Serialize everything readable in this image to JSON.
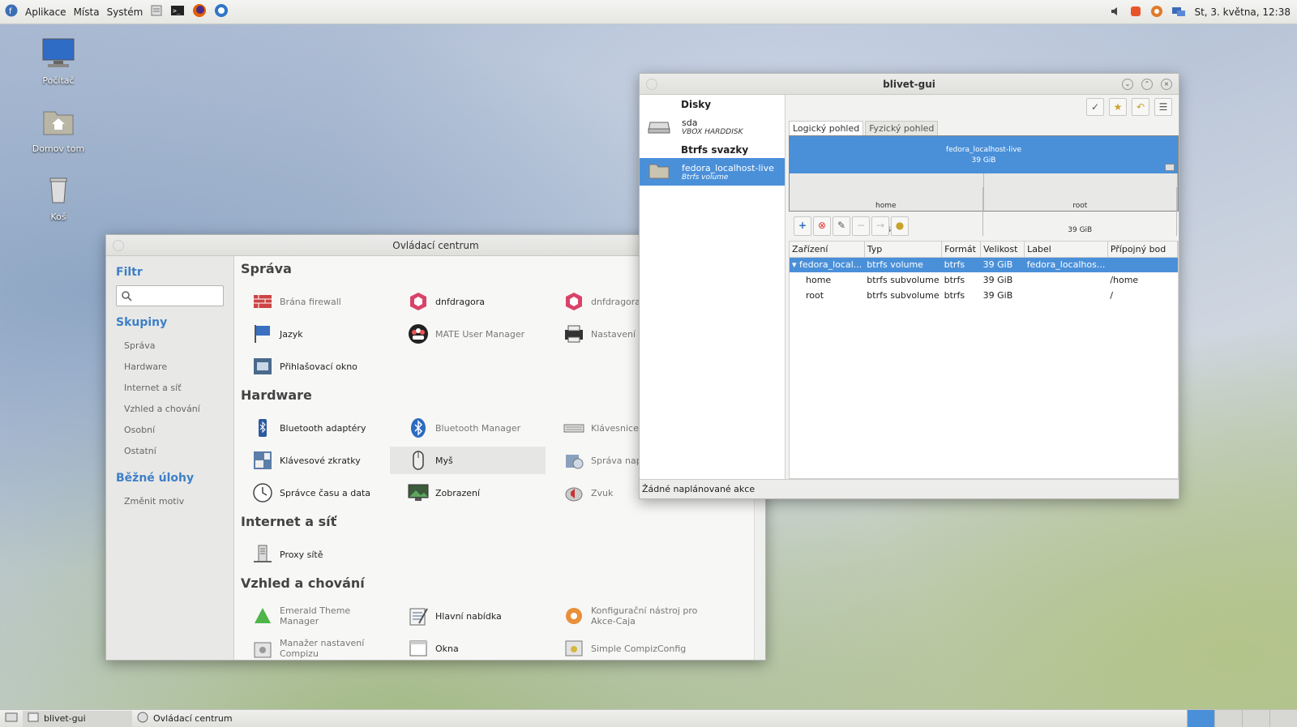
{
  "topbar": {
    "menus": [
      "Aplikace",
      "Místa",
      "Systém"
    ],
    "clock": "St, 3. května, 12:38"
  },
  "desktop": {
    "icons": [
      "Počítač",
      "Domov tom",
      "Koš"
    ]
  },
  "control_center": {
    "title": "Ovládací centrum",
    "filter_heading": "Filtr",
    "search_placeholder": "",
    "groups_heading": "Skupiny",
    "groups": [
      "Správa",
      "Hardware",
      "Internet a síť",
      "Vzhled a chování",
      "Osobní",
      "Ostatní"
    ],
    "tasks_heading": "Běžné úlohy",
    "tasks": [
      "Změnit motiv"
    ],
    "sections": [
      {
        "title": "Správa",
        "items": [
          "Brána firewall",
          "dnfdragora",
          "dnfdragora",
          "Jazyk",
          "MATE User Manager",
          "Nastavení",
          "Přihlašovací okno"
        ]
      },
      {
        "title": "Hardware",
        "items": [
          "Bluetooth adaptéry",
          "Bluetooth Manager",
          "Klávesnice",
          "Klávesové zkratky",
          "Myš",
          "Správa napájení",
          "Správce času a data",
          "Zobrazení",
          "Zvuk"
        ]
      },
      {
        "title": "Internet a síť",
        "items": [
          "Proxy sítě"
        ]
      },
      {
        "title": "Vzhled a chování",
        "items": [
          "Emerald Theme Manager",
          "Hlavní nabídka",
          "Konfigurační nástroj pro Akce-Caja",
          "Manažer nastavení Compizu",
          "Okna",
          "Simple CompizConfig"
        ]
      }
    ]
  },
  "blivet": {
    "title": "blivet-gui",
    "disks_heading": "Disky",
    "disk": {
      "name": "sda",
      "model": "VBOX HARDDISK"
    },
    "btrfs_heading": "Btrfs svazky",
    "volume": {
      "name": "fedora_localhost-live",
      "type": "Btrfs volume"
    },
    "tabs": [
      "Logický pohled",
      "Fyzický pohled"
    ],
    "visual": {
      "top_name": "fedora_localhost-live",
      "top_size": "39 GiB",
      "parts": [
        {
          "name": "home",
          "size": "39 GiB"
        },
        {
          "name": "root",
          "size": "39 GiB"
        }
      ]
    },
    "columns": [
      "Zařízení",
      "Typ",
      "Formát",
      "Velikost",
      "Label",
      "Přípojný bod"
    ],
    "rows": [
      [
        "fedora_local...",
        "btrfs volume",
        "btrfs",
        "39 GiB",
        "fedora_localhos...",
        ""
      ],
      [
        "home",
        "btrfs subvolume",
        "btrfs",
        "39 GiB",
        "",
        "/home"
      ],
      [
        "root",
        "btrfs subvolume",
        "btrfs",
        "39 GiB",
        "",
        "/"
      ]
    ],
    "status": "Žádné naplánované akce"
  },
  "taskbar": {
    "tasks": [
      "blivet-gui",
      "Ovládací centrum"
    ]
  },
  "colors": {
    "accent": "#4a90d9",
    "heading_blue": "#3d7fc8"
  }
}
